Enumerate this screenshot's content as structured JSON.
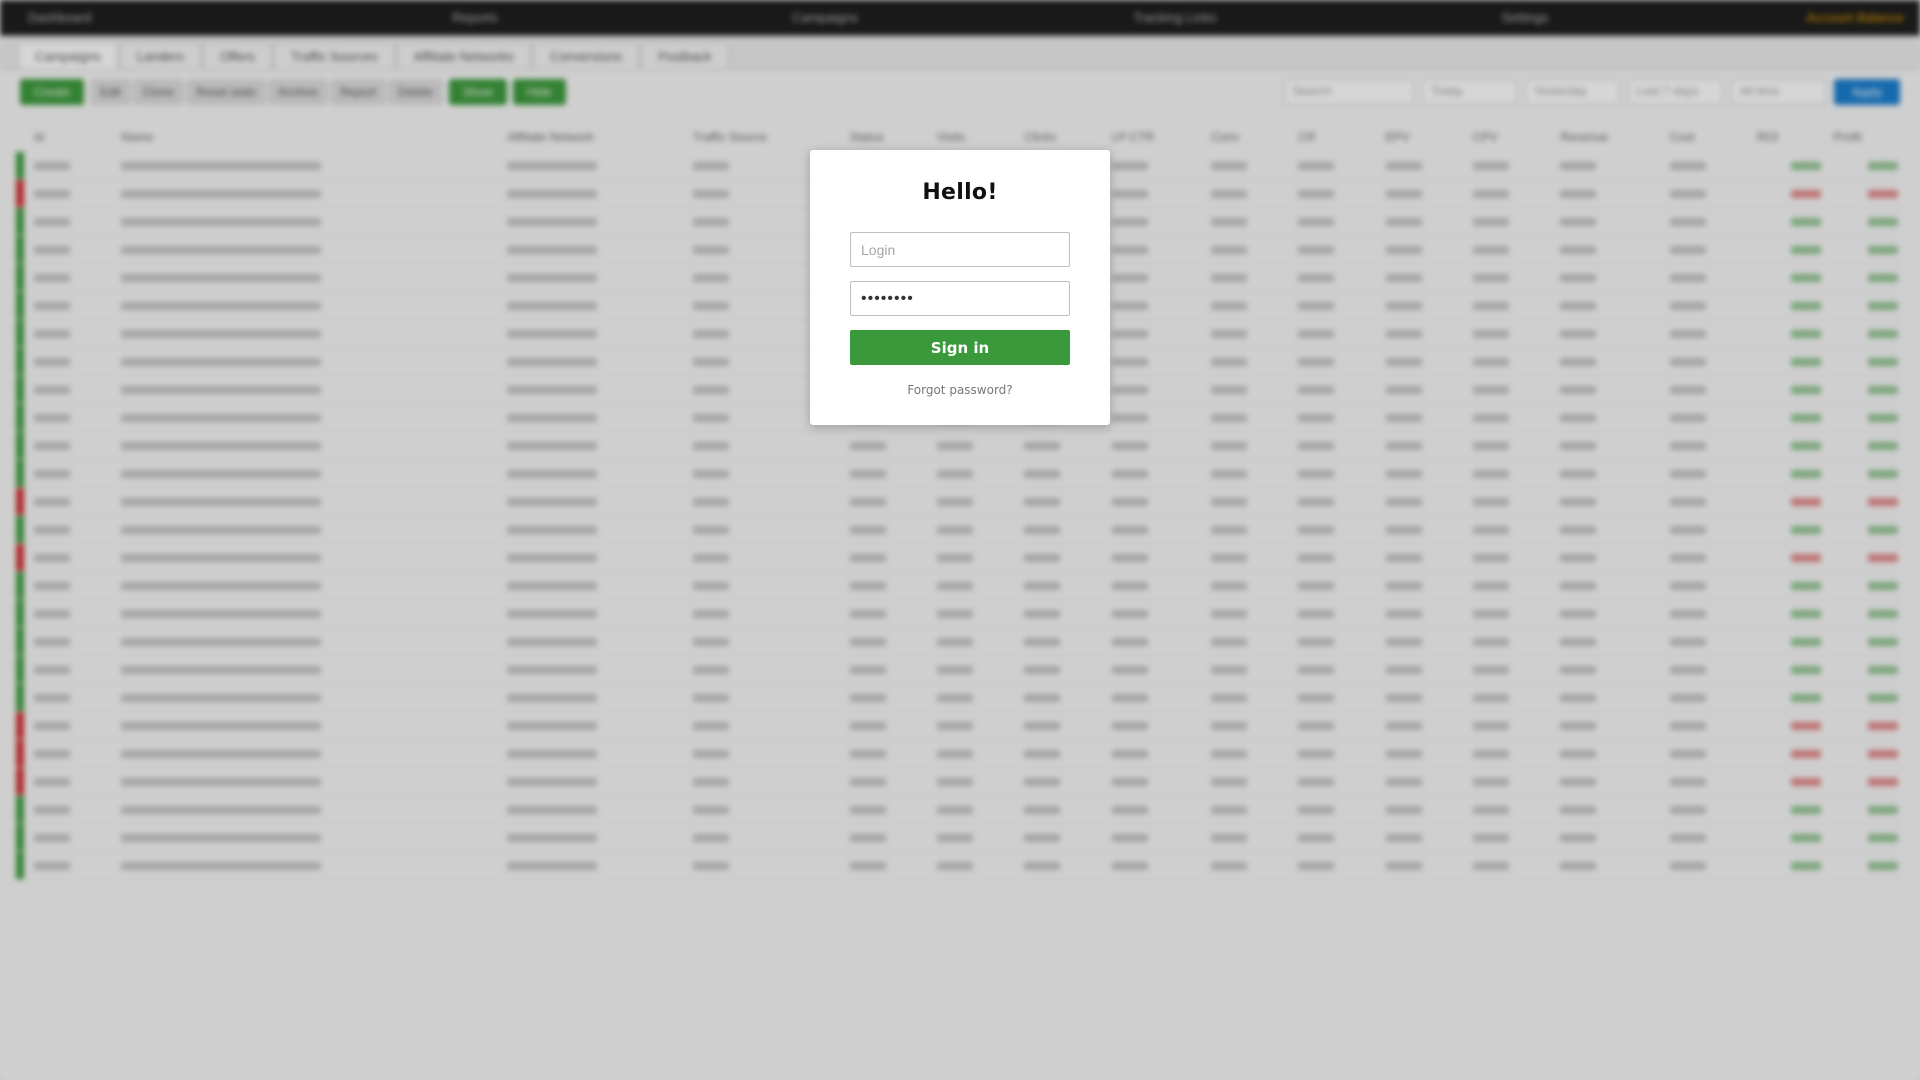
{
  "background": {
    "topbar": [
      "Dashboard",
      "Reports",
      "Campaigns",
      "Tracking Links",
      "Settings",
      "Account Balance"
    ],
    "tabs": [
      "Campaigns",
      "Landers",
      "Offers",
      "Traffic Sources",
      "Affiliate Networks",
      "Conversions",
      "Postback"
    ],
    "toolbar": {
      "primary": "Create",
      "actions": [
        "Edit",
        "Clone",
        "Reset stats",
        "Archive",
        "Report",
        "Delete"
      ],
      "secondary": [
        "Show",
        "Hide"
      ],
      "search_placeholder": "Search",
      "filters": [
        "Today",
        "Yesterday",
        "Last 7 days",
        "All time"
      ],
      "apply": "Apply"
    },
    "columns": [
      "Id",
      "Name",
      "Affiliate Network",
      "Traffic Source",
      "Status",
      "Visits",
      "Clicks",
      "LP CTR",
      "Conv",
      "CR",
      "EPV",
      "CPV",
      "Revenue",
      "Cost",
      "ROI",
      "Profit"
    ]
  },
  "login": {
    "title": "Hello!",
    "login_placeholder": "Login",
    "password_value": "********",
    "signin_label": "Sign in",
    "forgot_label": "Forgot password?"
  },
  "colors": {
    "primary_green": "#3a993a",
    "positive": "#3d9b3d",
    "negative": "#d03030",
    "topbar": "#1e1e1e"
  }
}
